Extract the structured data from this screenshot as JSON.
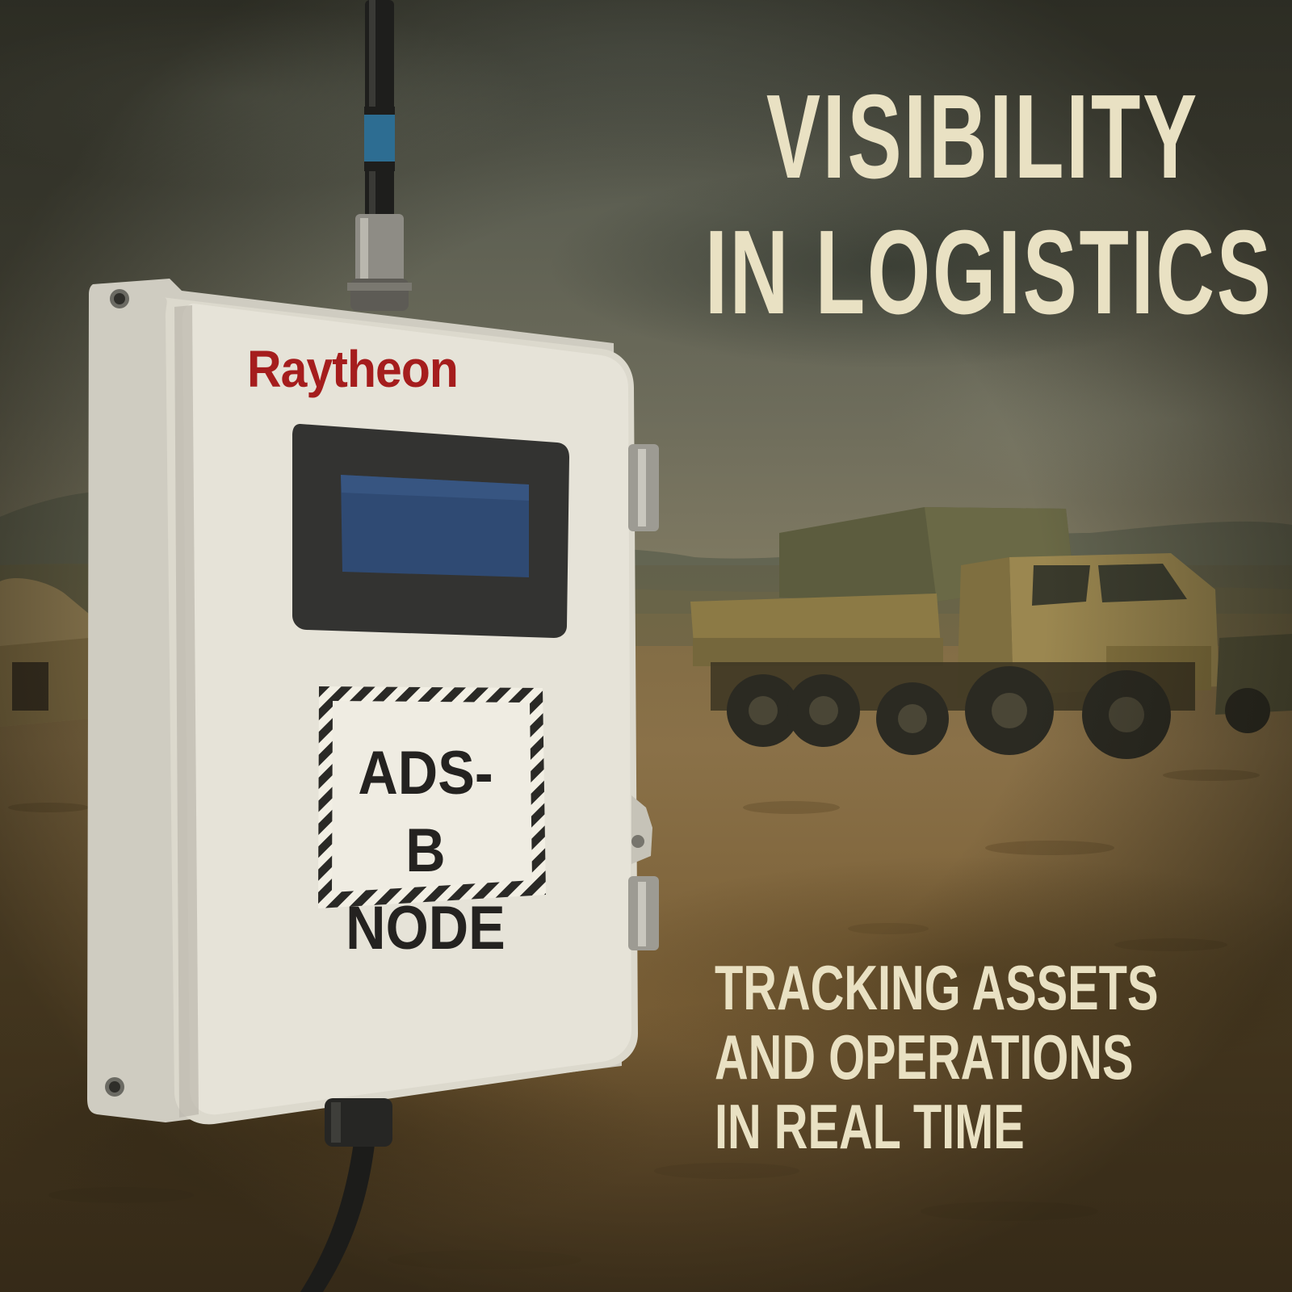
{
  "poster": {
    "headline_line1": "VISIBILITY",
    "headline_line2": "IN LOGISTICS",
    "tagline_line1": "TRACKING ASSETS",
    "tagline_line2": "AND OPERATIONS",
    "tagline_line3": "IN REAL TIME"
  },
  "device": {
    "brand": "Raytheon",
    "label_line1": "ADS-B",
    "label_line2": "NODE"
  },
  "colors": {
    "headline_text": "#e9e1c3",
    "brand_red": "#a51d1d",
    "enclosure": "#dedbd0",
    "truck_tan": "#8c7a45",
    "ground": "#7d6a44",
    "sky": "#5d5f52"
  }
}
